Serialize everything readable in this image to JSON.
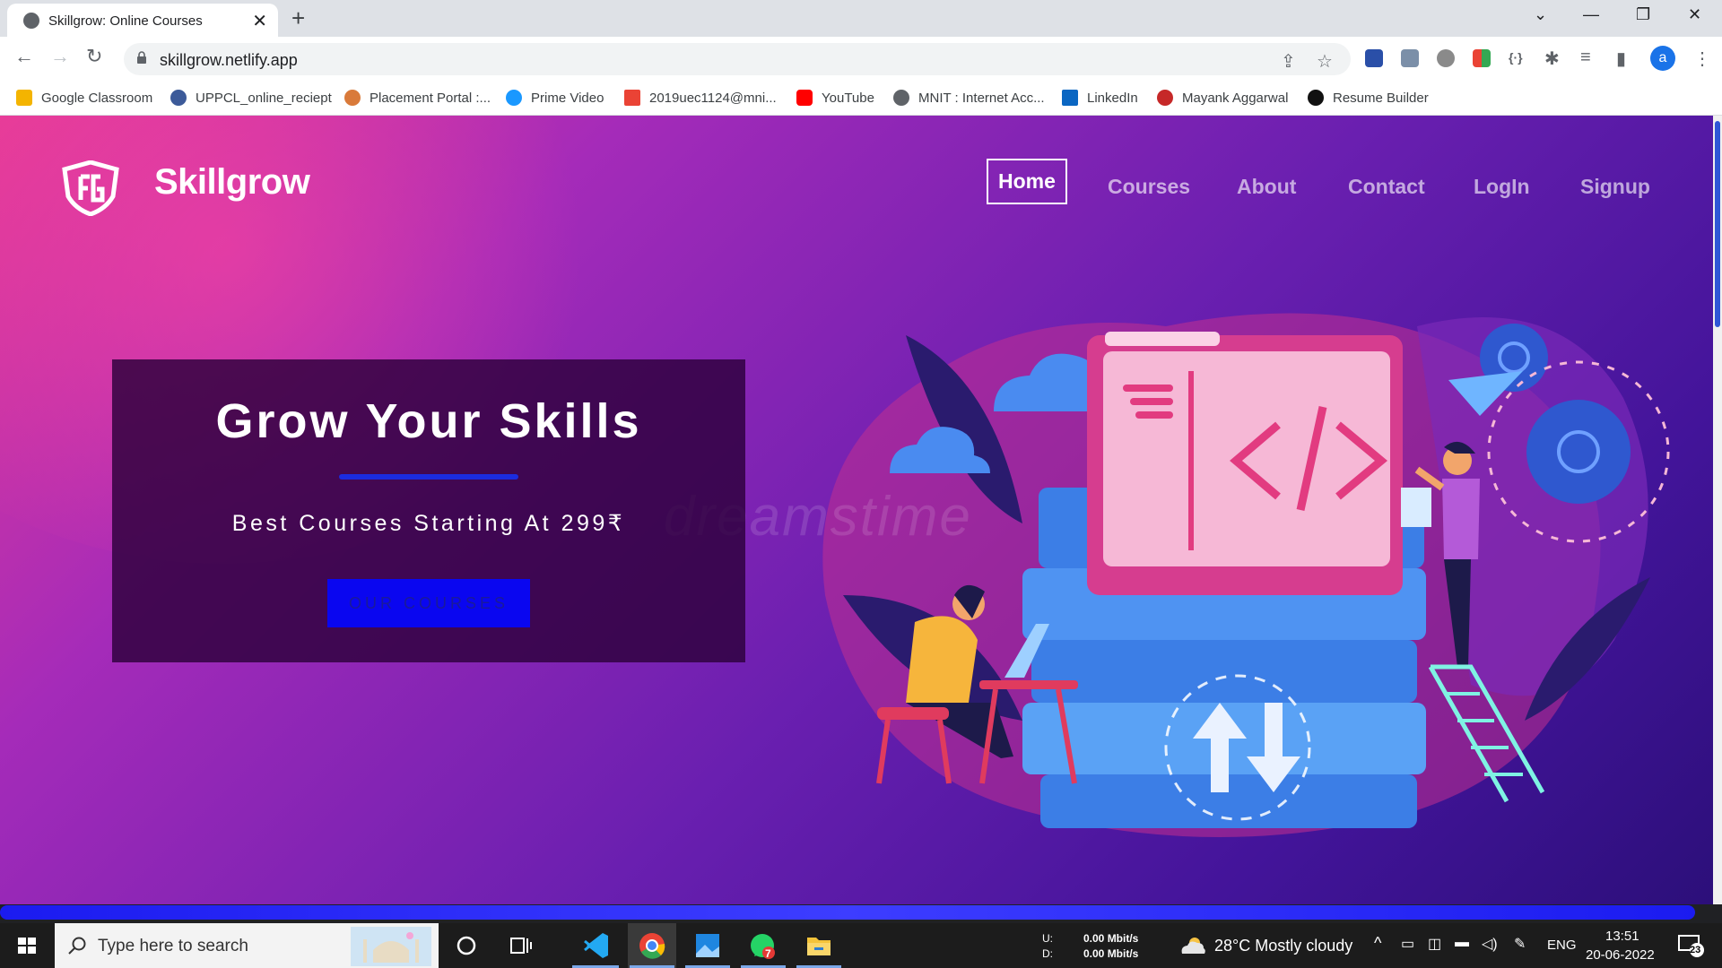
{
  "browser": {
    "tab_title": "Skillgrow: Online Courses",
    "url": "skillgrow.netlify.app",
    "profile_initial": "a"
  },
  "bookmarks": [
    {
      "label": "Google Classroom",
      "icon": "classroom-icon",
      "color": "#f4b400"
    },
    {
      "label": "UPPCL_online_reciept",
      "icon": "globe-icon",
      "color": "#3c5a99"
    },
    {
      "label": "Placement Portal :...",
      "icon": "portal-icon",
      "color": "#d97a3a"
    },
    {
      "label": "Prime Video",
      "icon": "prime-video-icon",
      "color": "#1a98ff"
    },
    {
      "label": "2019uec1124@mni...",
      "icon": "gmail-icon",
      "color": "#ea4335"
    },
    {
      "label": "YouTube",
      "icon": "youtube-icon",
      "color": "#ff0000"
    },
    {
      "label": "MNIT : Internet Acc...",
      "icon": "globe-icon",
      "color": "#5f6368"
    },
    {
      "label": "LinkedIn",
      "icon": "linkedin-icon",
      "color": "#0a66c2"
    },
    {
      "label": "Mayank Aggarwal",
      "icon": "profile-icon",
      "color": "#c62828"
    },
    {
      "label": "Resume Builder",
      "icon": "resume-icon",
      "color": "#111111"
    }
  ],
  "site": {
    "brand": "Skillgrow",
    "nav": [
      "Home",
      "Courses",
      "About",
      "Contact",
      "LogIn",
      "Signup"
    ],
    "active_nav": "Home",
    "hero_title": "Grow Your Skills",
    "hero_subtitle": "Best Courses Starting At 299₹",
    "hero_button": "OUR COURSES",
    "watermark": "dreamstime"
  },
  "taskbar": {
    "search_placeholder": "Type here to search",
    "net_up_label": "U:",
    "net_down_label": "D:",
    "net_up": "0.00 Mbit/s",
    "net_down": "0.00 Mbit/s",
    "weather": "28°C  Mostly cloudy",
    "language": "ENG",
    "time": "13:51",
    "date": "20-06-2022",
    "notifications": "23",
    "whatsapp_badge": "7"
  },
  "colors": {
    "accent_blue": "#0a06f0",
    "hero_gradient_start": "#e43a97",
    "hero_gradient_end": "#2c0f7a"
  }
}
